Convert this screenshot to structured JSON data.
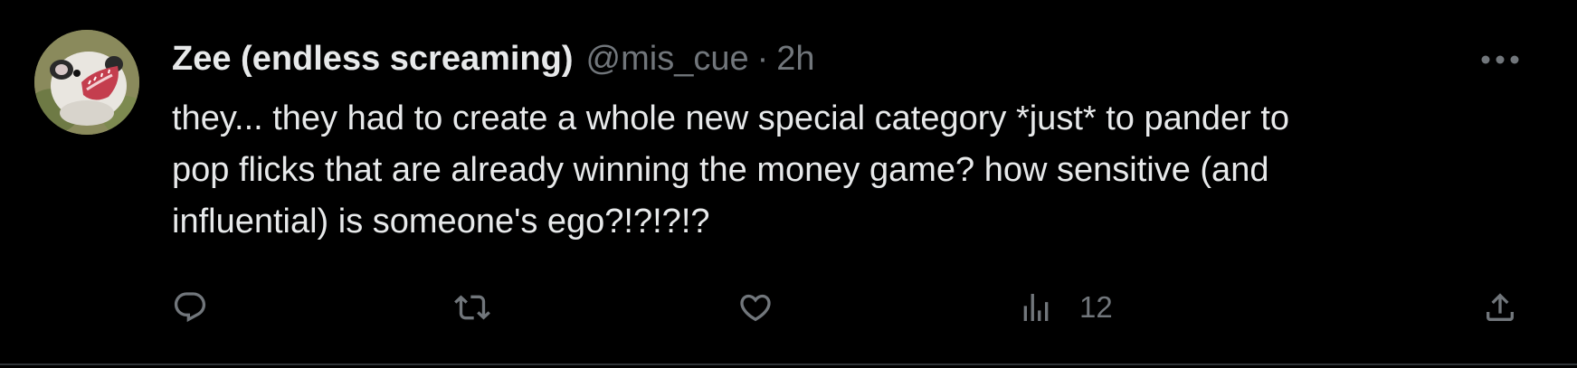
{
  "tweet": {
    "author": {
      "display_name": "Zee (endless screaming)",
      "handle": "@mis_cue",
      "avatar_icon": "opossum-avatar"
    },
    "separator": "·",
    "time": "2h",
    "text": "they... they had to create a whole new special category *just* to pander to\npop flicks that are already winning the money game? how sensitive (and\ninfluential) is someone's ego?!?!?!?",
    "actions": {
      "reply_icon": "reply-icon",
      "retweet_icon": "retweet-icon",
      "like_icon": "heart-icon",
      "views_icon": "views-icon",
      "views_count": "12",
      "share_icon": "share-icon"
    },
    "more_icon": "more-icon"
  },
  "colors": {
    "background": "#000000",
    "text_primary": "#e7e9ea",
    "text_secondary": "#71767b",
    "icon": "#71767b",
    "divider": "#2f3336"
  }
}
